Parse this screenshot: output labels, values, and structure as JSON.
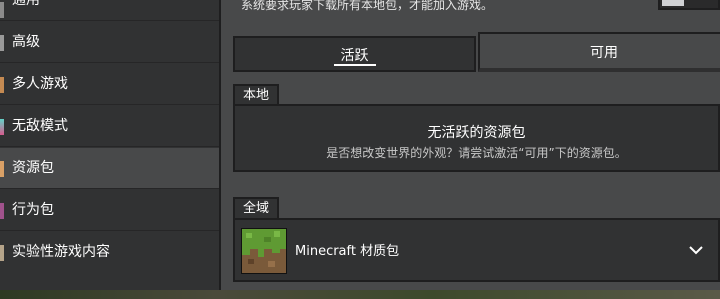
{
  "sidebar": {
    "items": [
      {
        "label": "通用",
        "icon": "general-icon",
        "color": "#8b8b8b"
      },
      {
        "label": "高级",
        "icon": "advanced-icon",
        "color": "#9a9a9a"
      },
      {
        "label": "多人游戏",
        "icon": "multiplayer-icon",
        "color": "#c48a52"
      },
      {
        "label": "无敌模式",
        "icon": "cheats-icon",
        "color": "#63d2c8"
      },
      {
        "label": "资源包",
        "icon": "resource-pack-icon",
        "color": "#d9a066"
      },
      {
        "label": "行为包",
        "icon": "behavior-pack-icon",
        "color": "#a0528c"
      },
      {
        "label": "实验性游戏内容",
        "icon": "experimental-icon",
        "color": "#b5a48a"
      }
    ],
    "active_index": 4
  },
  "main": {
    "top_note": "系统要求玩家下载所有本地包，才能加入游戏。",
    "tabs": [
      {
        "label": "活跃",
        "active": true
      },
      {
        "label": "可用",
        "active": false
      }
    ],
    "local": {
      "label": "本地",
      "empty_title": "无活跃的资源包",
      "empty_subtitle": "是否想改变世界的外观？请尝试激活“可用”下的资源包。"
    },
    "global": {
      "label": "全域",
      "pack_name": "Minecraft 材质包"
    }
  },
  "colors": {
    "panel": "#313233",
    "background": "#48494a",
    "border": "#1e1e1f"
  }
}
